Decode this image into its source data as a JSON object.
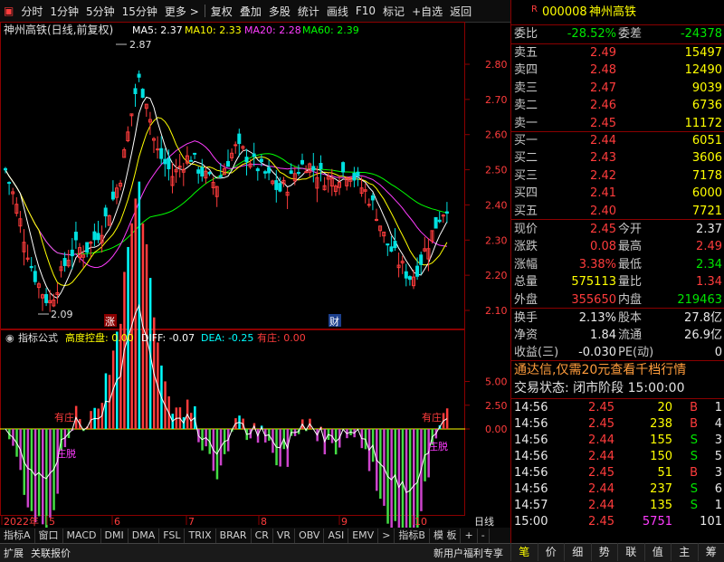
{
  "toolbar": {
    "logo_icon": "app-icon",
    "items": [
      "分时",
      "1分钟",
      "5分钟",
      "15分钟",
      "更多 >",
      "复权",
      "叠加",
      "多股",
      "统计",
      "画线",
      "F10",
      "标记",
      "+自选",
      "返回"
    ]
  },
  "chart": {
    "title": "神州高铁(日线,前复权)",
    "ma5": "MA5: 2.37",
    "ma10": "MA10: 2.33",
    "ma20": "MA20: 2.28",
    "ma60": "MA60: 2.39",
    "high_mark": "2.87",
    "low_mark": "2.09",
    "price_ticks": [
      "2.80",
      "2.70",
      "2.60",
      "2.50",
      "2.40",
      "2.30",
      "2.20",
      "2.10"
    ],
    "event_zhang": "涨",
    "event_cai": "财",
    "indicator_header": "指标公式",
    "ind_kongpan": "高度控盘: 0.00",
    "ind_diff": "DIFF: -0.07",
    "ind_dea": "DEA: -0.25",
    "ind_youzhuang": "有庄: 0.00",
    "ind_ticks": [
      "5.00",
      "2.50",
      "0.00"
    ],
    "ann_youzhuang_left": "有庄",
    "ann_zhuangtuo_left": "庄脱",
    "ann_youzhuang_right": "有庄",
    "ann_zhuangtuo_right": "庄脱",
    "date_labels": [
      "2022年",
      "5",
      "6",
      "7",
      "8",
      "9",
      "10"
    ],
    "period_label": "日线",
    "colors": {
      "up": "#ff3c3c",
      "down": "#00e0e0",
      "ma5": "#ffffff",
      "ma10": "#ffff00",
      "ma20": "#ff3cff",
      "ma60": "#00ff00"
    }
  },
  "tabs": [
    "指标A",
    "窗口",
    "MACD",
    "DMI",
    "DMA",
    "FSL",
    "TRIX",
    "BRAR",
    "CR",
    "VR",
    "OBV",
    "ASI",
    "EMV",
    ">",
    "指标B",
    "模 板",
    "+",
    "-"
  ],
  "status": [
    "扩展",
    "关联报价",
    "新用户福利专享"
  ],
  "stock": {
    "badge": "R",
    "code": "000008",
    "name": "神州高铁",
    "weibi_label": "委比",
    "weibi": "-28.52%",
    "weicha_label": "委差",
    "weicha": "-24378",
    "sell": [
      {
        "label": "卖五",
        "price": "2.49",
        "vol": "15497"
      },
      {
        "label": "卖四",
        "price": "2.48",
        "vol": "12490"
      },
      {
        "label": "卖三",
        "price": "2.47",
        "vol": "9039"
      },
      {
        "label": "卖二",
        "price": "2.46",
        "vol": "6736"
      },
      {
        "label": "卖一",
        "price": "2.45",
        "vol": "11172"
      }
    ],
    "buy": [
      {
        "label": "买一",
        "price": "2.44",
        "vol": "6051"
      },
      {
        "label": "买二",
        "price": "2.43",
        "vol": "3606"
      },
      {
        "label": "买三",
        "price": "2.42",
        "vol": "7178"
      },
      {
        "label": "买四",
        "price": "2.41",
        "vol": "6000"
      },
      {
        "label": "买五",
        "price": "2.40",
        "vol": "7721"
      }
    ],
    "quote": [
      {
        "l1": "现价",
        "v1": "2.45",
        "c1": "red",
        "l2": "今开",
        "v2": "2.37",
        "c2": "white"
      },
      {
        "l1": "涨跌",
        "v1": "0.08",
        "c1": "red",
        "l2": "最高",
        "v2": "2.49",
        "c2": "red"
      },
      {
        "l1": "涨幅",
        "v1": "3.38%",
        "c1": "red",
        "l2": "最低",
        "v2": "2.34",
        "c2": "green"
      },
      {
        "l1": "总量",
        "v1": "575113",
        "c1": "yellow",
        "l2": "量比",
        "v2": "1.34",
        "c2": "red"
      },
      {
        "l1": "外盘",
        "v1": "355650",
        "c1": "red",
        "l2": "内盘",
        "v2": "219463",
        "c2": "green"
      }
    ],
    "fin": [
      {
        "l1": "换手",
        "v1": "2.13%",
        "l2": "股本",
        "v2": "27.8亿"
      },
      {
        "l1": "净资",
        "v1": "1.84",
        "l2": "流通",
        "v2": "26.9亿"
      },
      {
        "l1": "收益(三)",
        "v1": "-0.030",
        "l2": "PE(动)",
        "v2": "0"
      }
    ],
    "promo": "通达信,仅需20元查看千档行情",
    "trade_status": "交易状态: 闭市阶段 15:00:00",
    "ticks": [
      {
        "t": "14:56",
        "p": "2.45",
        "pc": "red",
        "v": "20",
        "d": "B",
        "dc": "red",
        "n": "1"
      },
      {
        "t": "14:56",
        "p": "2.45",
        "pc": "red",
        "v": "238",
        "d": "B",
        "dc": "red",
        "n": "4"
      },
      {
        "t": "14:56",
        "p": "2.44",
        "pc": "red",
        "v": "155",
        "d": "S",
        "dc": "green",
        "n": "3"
      },
      {
        "t": "14:56",
        "p": "2.44",
        "pc": "red",
        "v": "150",
        "d": "S",
        "dc": "green",
        "n": "5"
      },
      {
        "t": "14:56",
        "p": "2.45",
        "pc": "red",
        "v": "51",
        "d": "B",
        "dc": "red",
        "n": "3"
      },
      {
        "t": "14:56",
        "p": "2.44",
        "pc": "red",
        "v": "237",
        "d": "S",
        "dc": "green",
        "n": "6"
      },
      {
        "t": "14:57",
        "p": "2.44",
        "pc": "red",
        "v": "135",
        "d": "S",
        "dc": "green",
        "n": "1"
      },
      {
        "t": "15:00",
        "p": "2.45",
        "pc": "red",
        "v": "5751",
        "d": "",
        "dc": "magenta",
        "n": "101"
      }
    ],
    "bottom_tabs": [
      "笔",
      "价",
      "细",
      "势",
      "联",
      "值",
      "主",
      "筹"
    ]
  }
}
